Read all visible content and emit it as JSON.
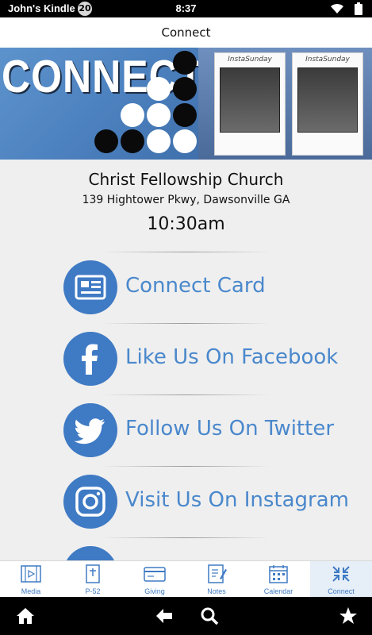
{
  "status_bar": {
    "device_name": "John's Kindle",
    "notification_count": "20",
    "time": "8:37"
  },
  "header": {
    "title": "Connect"
  },
  "banner": {
    "word": "CONNECT",
    "frame_brand": "InstaSunday"
  },
  "church": {
    "name": "Christ Fellowship Church",
    "address": "139 Hightower Pkwy, Dawsonville GA",
    "service_time": "10:30am"
  },
  "links": [
    {
      "label": "Connect Card",
      "icon": "card-icon"
    },
    {
      "label": "Like Us On Facebook",
      "icon": "facebook-icon"
    },
    {
      "label": "Follow Us On Twitter",
      "icon": "twitter-icon"
    },
    {
      "label": "Visit Us On Instagram",
      "icon": "instagram-icon"
    }
  ],
  "tabs": [
    {
      "label": "Media",
      "icon": "film-icon"
    },
    {
      "label": "P-52",
      "icon": "bible-icon"
    },
    {
      "label": "Giving",
      "icon": "credit-card-icon"
    },
    {
      "label": "Notes",
      "icon": "notes-icon"
    },
    {
      "label": "Calendar",
      "icon": "calendar-icon"
    },
    {
      "label": "Connect",
      "icon": "connect-icon",
      "active": true
    }
  ],
  "nav_bar": {
    "icons": [
      "home-icon",
      "back-icon",
      "search-icon",
      "favorites-icon"
    ]
  },
  "colors": {
    "accent": "#3f7ac4",
    "link_text": "#4a88cc",
    "background": "#efefef"
  }
}
